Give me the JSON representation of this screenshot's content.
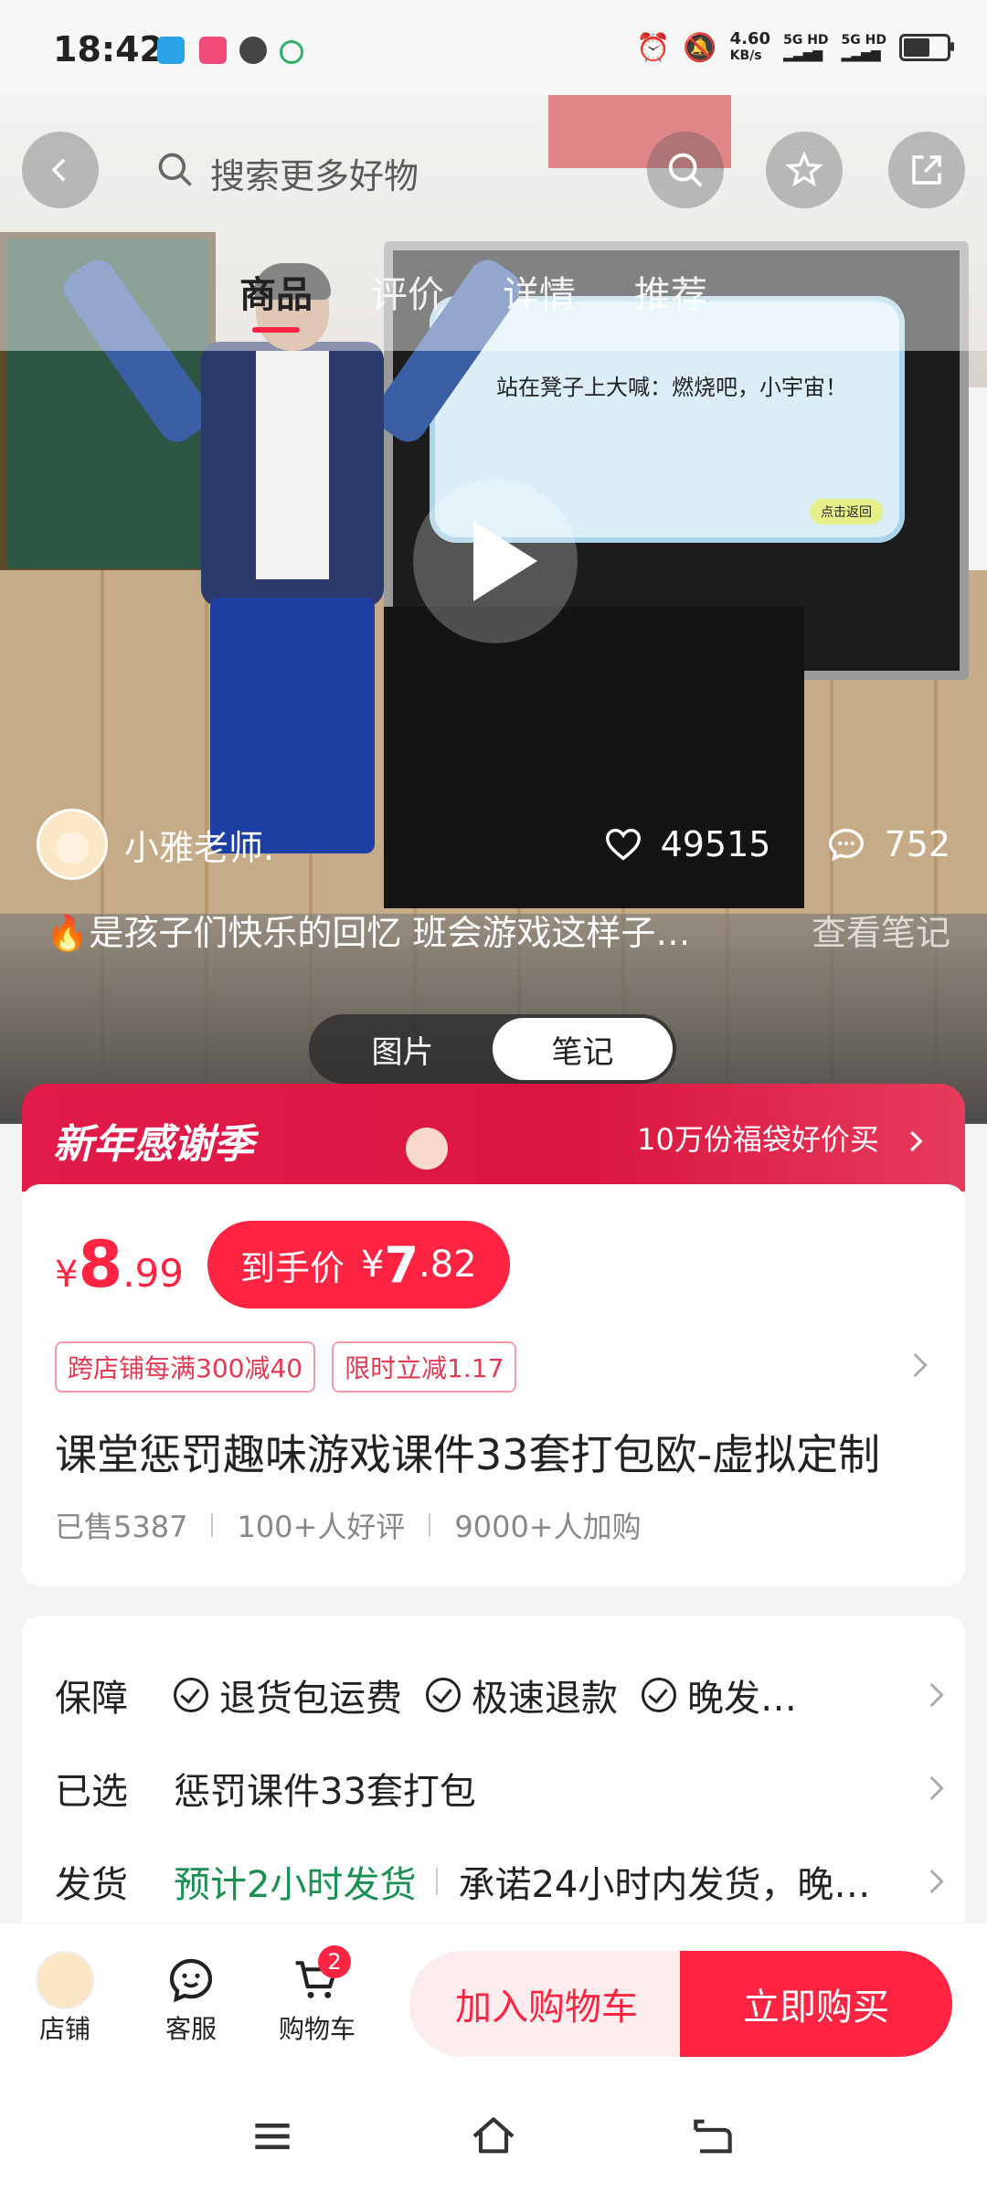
{
  "status_bar": {
    "time": "18:42",
    "network_speed": "4.60",
    "network_unit": "KB/s",
    "sim1": "5G HD",
    "sim2": "5G HD"
  },
  "top_nav": {
    "search_placeholder": "搜索更多好物",
    "tabs": [
      {
        "label": "商品"
      },
      {
        "label": "评价"
      },
      {
        "label": "详情"
      },
      {
        "label": "推荐"
      }
    ]
  },
  "hero": {
    "screen_text": "站在凳子上大喊：燃烧吧，小宇宙！",
    "screen_btn": "点击返回"
  },
  "author": {
    "name": "小雅老师.",
    "likes": "49515",
    "comments": "752"
  },
  "note": {
    "emoji": "🔥",
    "text": "是孩子们快乐的回忆 班会游戏这样子…",
    "link": "查看笔记"
  },
  "segment": {
    "options": [
      "图片",
      "笔记"
    ],
    "selected": "笔记"
  },
  "promo": {
    "title": "新年感谢季",
    "right_text": "10万份福袋好价买"
  },
  "product": {
    "price_symbol": "¥",
    "price_int": "8",
    "price_dec": ".99",
    "final_label": "到手价",
    "final_symbol": "¥",
    "final_int": "7",
    "final_dec": ".82",
    "coupons": [
      "跨店铺每满300减40",
      "限时立减1.17"
    ],
    "title": "课堂惩罚趣味游戏课件33套打包欧-虚拟定制",
    "sold": "已售5387",
    "reviews": "100+人好评",
    "carted": "9000+人加购"
  },
  "info": {
    "guarantee_label": "保障",
    "guarantees": [
      "退货包运费",
      "极速退款",
      "晚发…"
    ],
    "selected_label": "已选",
    "selected_value": "惩罚课件33套打包",
    "ship_label": "发货",
    "ship_eta": "预计2小时发货",
    "ship_promise": "承诺24小时内发货，晚…"
  },
  "bottom_bar": {
    "store": "店铺",
    "service": "客服",
    "cart": "购物车",
    "cart_count": "2",
    "add_cart": "加入购物车",
    "buy_now": "立即购买"
  },
  "colors": {
    "accent": "#ff2442",
    "promo": "#e31b4b",
    "green": "#1a8f52"
  }
}
